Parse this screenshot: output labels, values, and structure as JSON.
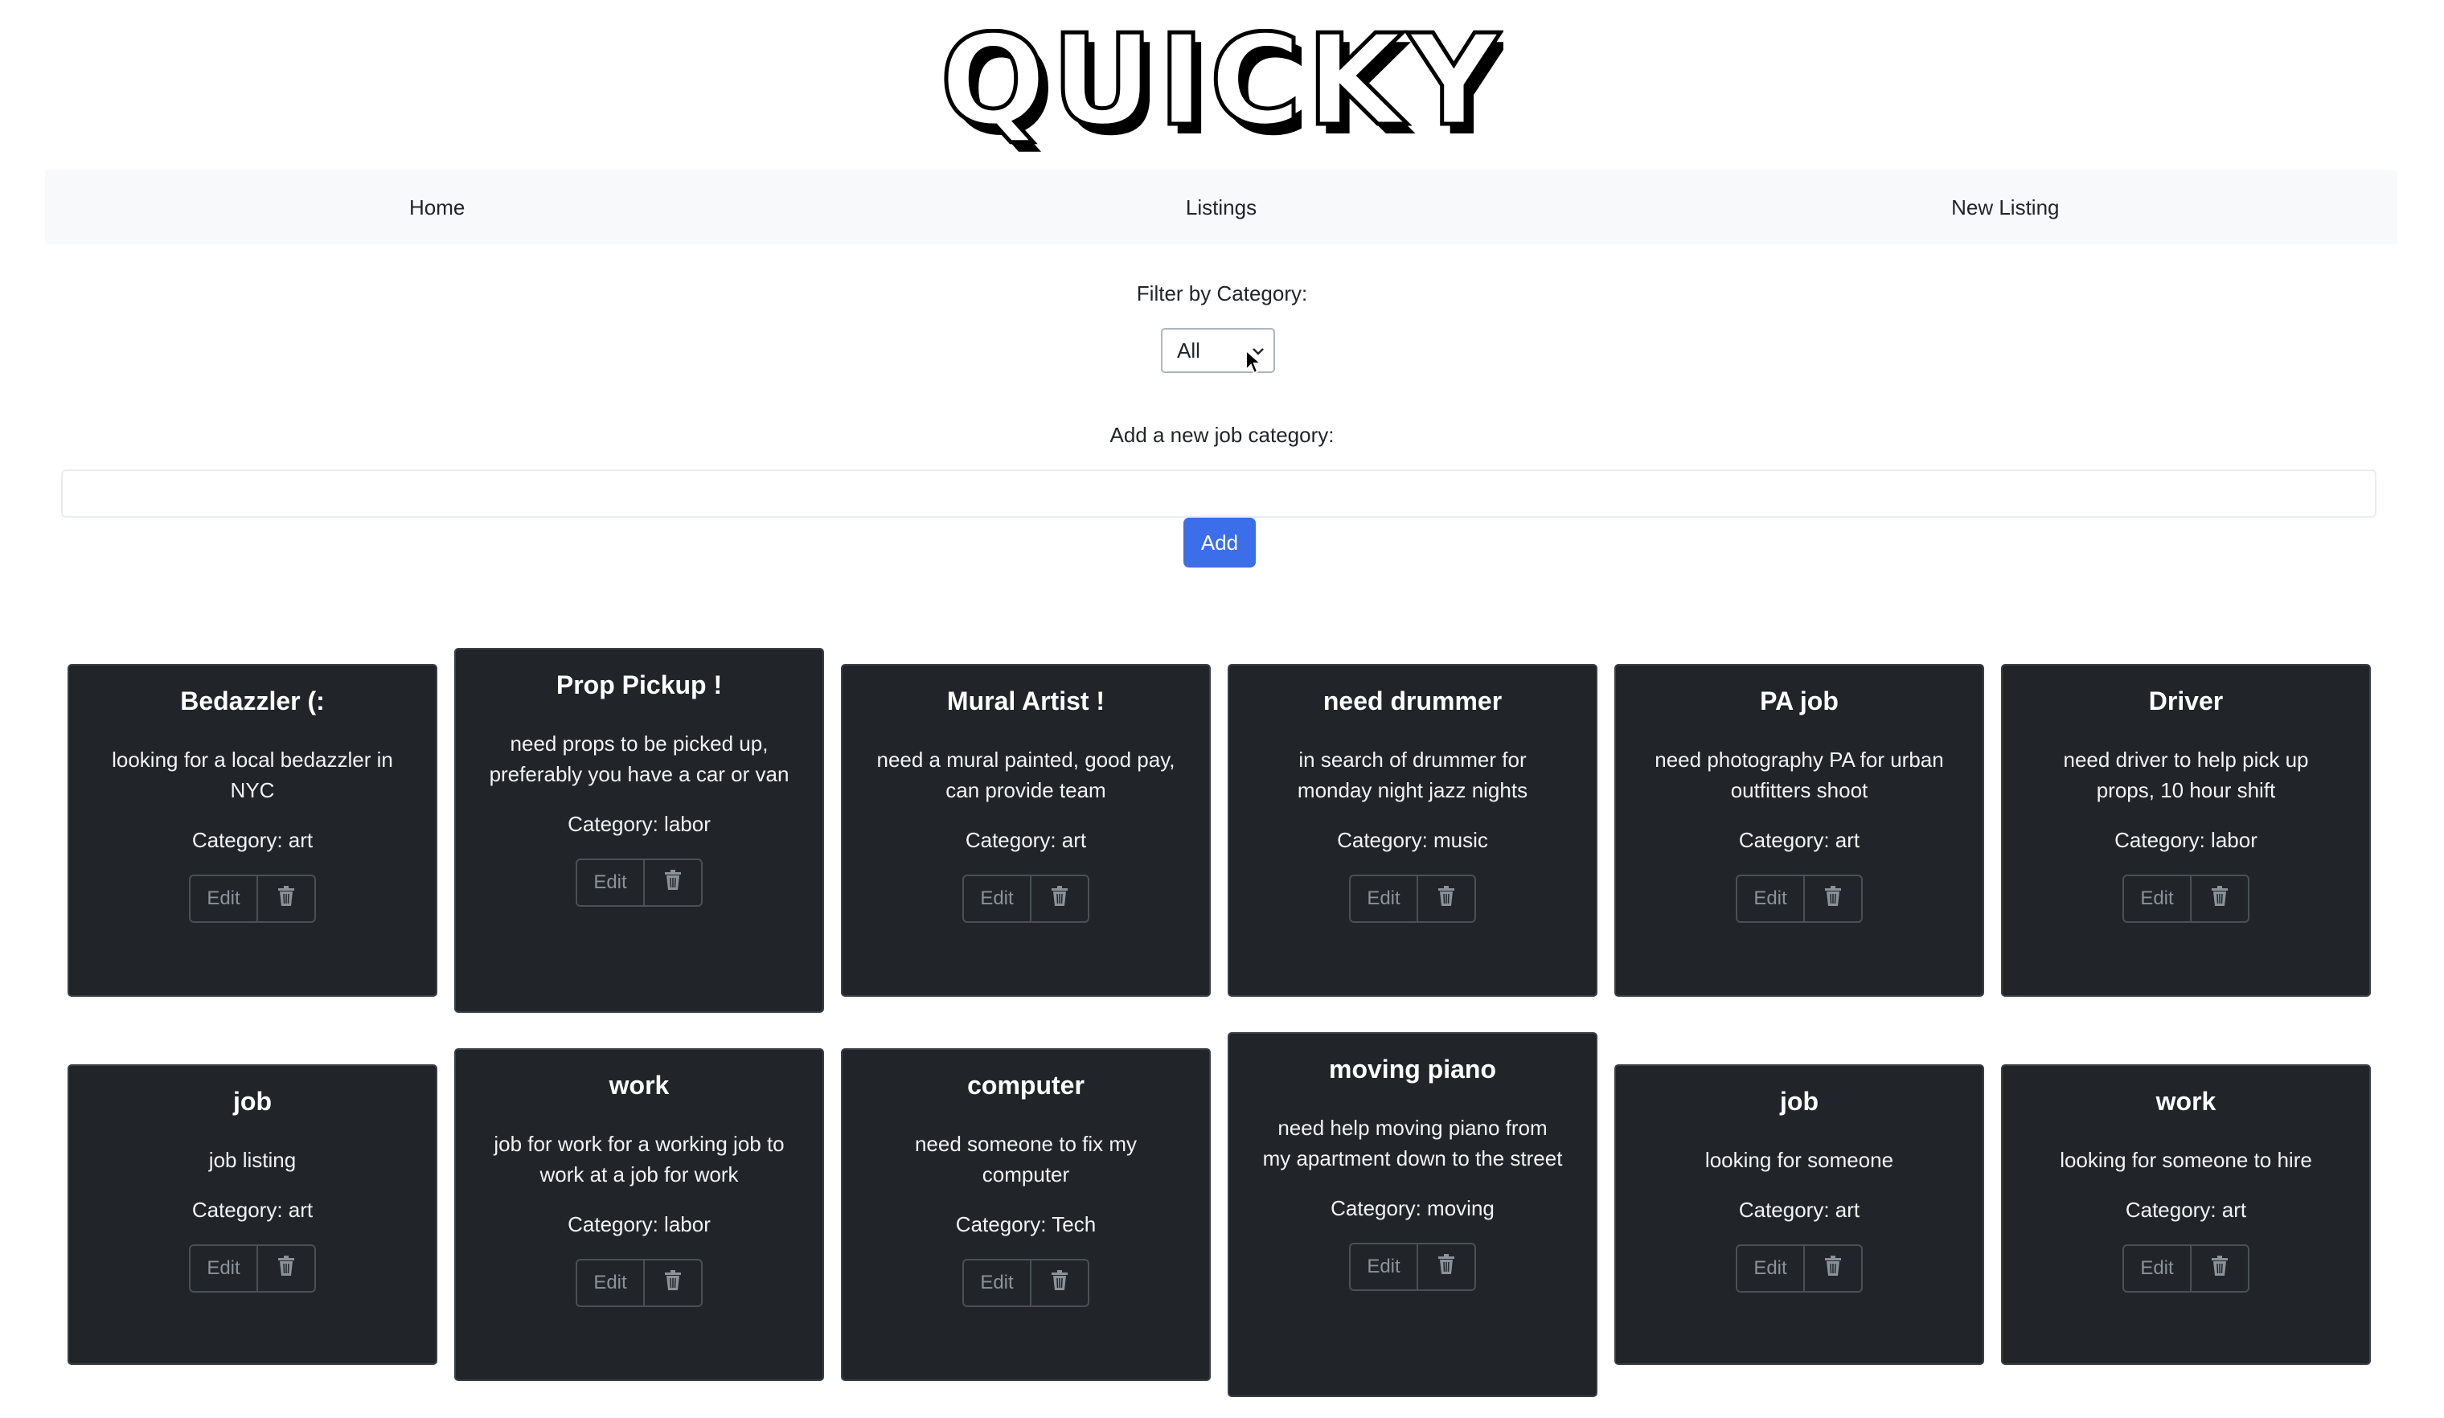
{
  "brand": {
    "logo_text": "QUICKY"
  },
  "nav": {
    "items": [
      {
        "label": "Home"
      },
      {
        "label": "Listings"
      },
      {
        "label": "New Listing"
      }
    ]
  },
  "filter": {
    "label": "Filter by Category:",
    "selected": "All"
  },
  "new_category": {
    "label": "Add a new job category:",
    "value": "",
    "button_label": "Add"
  },
  "card_buttons": {
    "edit_label": "Edit",
    "delete_icon": "trash-icon"
  },
  "listings": [
    {
      "title": "Bedazzler (:",
      "description": "looking for a local bedazzler in NYC",
      "category": "Category: art"
    },
    {
      "title": "Prop Pickup !",
      "description": "need props to be picked up, preferably you have a car or van",
      "category": "Category: labor"
    },
    {
      "title": "Mural Artist !",
      "description": "need a mural painted, good pay, can provide team",
      "category": "Category: art"
    },
    {
      "title": "need drummer",
      "description": "in search of drummer for monday night jazz nights",
      "category": "Category: music"
    },
    {
      "title": "PA job",
      "description": "need photography PA for urban outfitters shoot",
      "category": "Category: art"
    },
    {
      "title": "Driver",
      "description": "need driver to help pick up props, 10 hour shift",
      "category": "Category: labor"
    },
    {
      "title": "job",
      "description": "job listing",
      "category": "Category: art"
    },
    {
      "title": "work",
      "description": "job for work for a working job to work at a job for work",
      "category": "Category: labor"
    },
    {
      "title": "computer",
      "description": "need someone to fix my computer",
      "category": "Category: Tech"
    },
    {
      "title": "moving piano",
      "description": "need help moving piano from my apartment down to the street",
      "category": "Category: moving"
    },
    {
      "title": "job",
      "description": "looking for someone",
      "category": "Category: art"
    },
    {
      "title": "work",
      "description": "looking for someone to hire",
      "category": "Category: art"
    }
  ],
  "colors": {
    "card_bg": "#212529",
    "accent": "#3b6ee8",
    "nav_bg": "#f8f9fa"
  }
}
